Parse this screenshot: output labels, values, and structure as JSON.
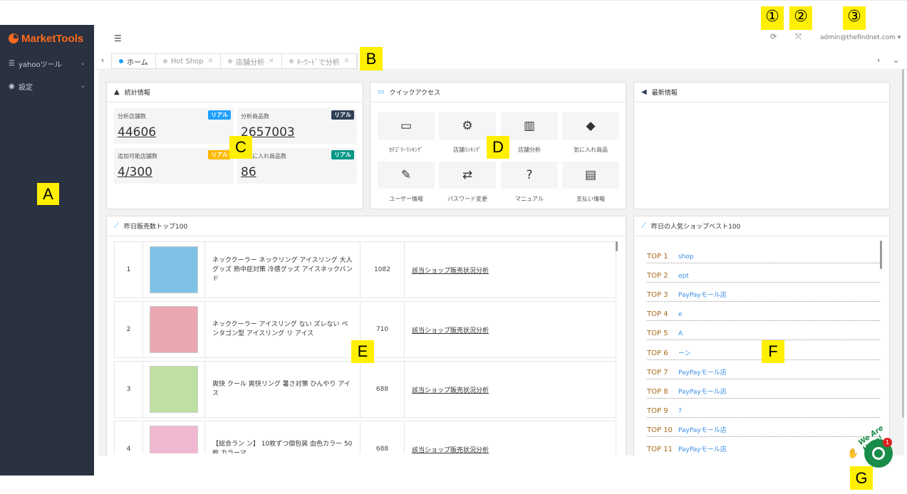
{
  "app": {
    "logo_text": "MarketTools",
    "brand_color": "#ff6a1c",
    "sidebar_bg": "#2a3140"
  },
  "sidebar": {
    "items": [
      {
        "label": "yahooツール",
        "icon": "sliders-icon"
      },
      {
        "label": "設定",
        "icon": "dashboard-icon"
      }
    ]
  },
  "header": {
    "menu_icon": "☰",
    "refresh_icon": "⟳",
    "fullscreen_icon": "⤧",
    "user": "admin@thefindnet.com",
    "user_caret": "▾"
  },
  "tabs": [
    {
      "label": "ホーム",
      "active": true
    },
    {
      "label": "Hot Shop",
      "active": false
    },
    {
      "label": "店舗分析",
      "active": false
    },
    {
      "label": "ｷｰﾜｰﾄﾞで分析",
      "active": false
    }
  ],
  "stats_panel": {
    "title": "統計情報",
    "items": [
      {
        "label": "分析店舗数",
        "badge": "リアル",
        "badge_color": "#1e9fff",
        "value": "44606"
      },
      {
        "label": "分析商品数",
        "badge": "リアル",
        "badge_color": "#2f4056",
        "value": "2657003"
      },
      {
        "label": "追加可能店舗数",
        "badge": "リアル",
        "badge_color": "#ffb800",
        "value": "4/300"
      },
      {
        "label": "お気に入れ商品数",
        "badge": "リアル",
        "badge_color": "#009688",
        "value": "86"
      }
    ]
  },
  "quick_access": {
    "title": "クイックアクセス",
    "items": [
      {
        "label": "ｶﾃｺﾞﾘｰﾗﾝｷﾝｸﾞ",
        "glyph": "▭"
      },
      {
        "label": "店舗ﾗﾝｷﾝｸﾞ",
        "glyph": "⚙"
      },
      {
        "label": "店舗分析",
        "glyph": "▥"
      },
      {
        "label": "気に入れ商品",
        "glyph": "◆"
      },
      {
        "label": "ユーザー情報",
        "glyph": "✎"
      },
      {
        "label": "パスワード変更",
        "glyph": "⇄"
      },
      {
        "label": "マニュアル",
        "glyph": "?"
      },
      {
        "label": "支払い情報",
        "glyph": "▤"
      }
    ]
  },
  "news_panel": {
    "title": "最新情報"
  },
  "top_sales": {
    "title": "昨日販売数トップ100",
    "rows": [
      {
        "rank": "1",
        "name": "ネッククーラー ネックリング アイスリング 大人 グッズ 熱中症対策 冷感グッズ アイスネックバンド",
        "count": "1082",
        "link": "該当ショップ販売状況分析",
        "thumb_color": "#7ec2e8"
      },
      {
        "rank": "2",
        "name": "ネッククーラー アイスリング ない ズレない ペンタゴン型 アイスリング リ アイス",
        "count": "710",
        "link": "該当ショップ販売状況分析",
        "thumb_color": "#e9a7b2"
      },
      {
        "rank": "3",
        "name": "爽快 クール 爽快リング 暑さ対策 ひんやり アイス",
        "count": "688",
        "link": "該当ショップ販売状況分析",
        "thumb_color": "#bfe0a0"
      },
      {
        "rank": "4",
        "name": "【総合ラン ン】 10枚ずつ個包装 血色カラー 50枚 カラーマ",
        "count": "688",
        "link": "該当ショップ販売状況分析",
        "thumb_color": "#f0b8d0"
      }
    ]
  },
  "top_shops": {
    "title": "昨日の人気ショップベスト100",
    "items": [
      {
        "rank": "TOP 1",
        "shop": "shop"
      },
      {
        "rank": "TOP 2",
        "shop": "ept"
      },
      {
        "rank": "TOP 3",
        "shop": "PayPayモール店"
      },
      {
        "rank": "TOP 4",
        "shop": "e"
      },
      {
        "rank": "TOP 5",
        "shop": "A"
      },
      {
        "rank": "TOP 6",
        "shop": "ーン"
      },
      {
        "rank": "TOP 7",
        "shop": "PayPayモール店"
      },
      {
        "rank": "TOP 8",
        "shop": "PayPayモール店"
      },
      {
        "rank": "TOP 9",
        "shop": "?"
      },
      {
        "rank": "TOP 10",
        "shop": "PayPayモール店"
      },
      {
        "rank": "TOP 11",
        "shop": "PayPayモール店"
      }
    ]
  },
  "chat_widget": {
    "caption": "We Are Here!",
    "badge": "1"
  },
  "annotations": {
    "A": "A",
    "B": "B",
    "C": "C",
    "D": "D",
    "E": "E",
    "F": "F",
    "G": "G",
    "n1": "①",
    "n2": "②",
    "n3": "③"
  }
}
